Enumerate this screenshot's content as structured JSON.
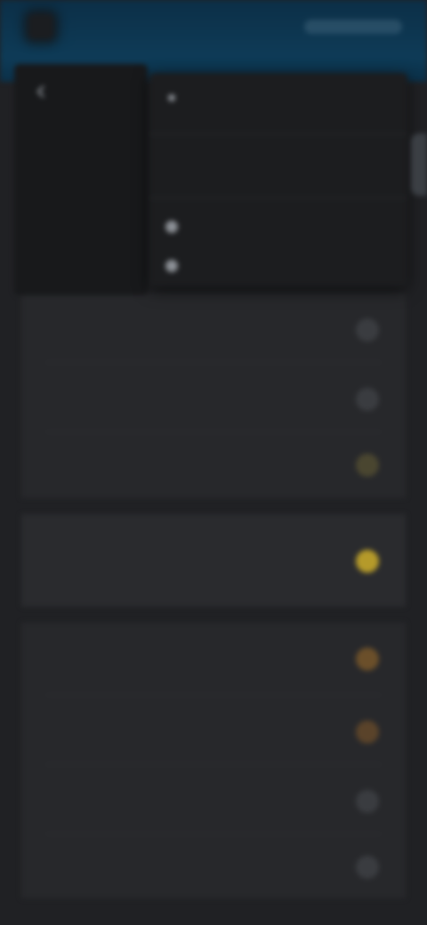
{
  "top_bar": {
    "title": "",
    "status": ""
  },
  "drawer": {
    "items": [
      {
        "sub": "",
        "main": ""
      },
      {
        "sub": "",
        "main": ""
      }
    ]
  },
  "menu": {
    "items": [
      {
        "label": "",
        "icon": "chevron-right-icon"
      },
      {
        "label": "",
        "icon": "none"
      },
      {
        "label": "",
        "icon": "circle-icon"
      },
      {
        "label": "",
        "icon": "circle-icon"
      }
    ]
  },
  "list": {
    "rows": [
      {
        "sub": "",
        "main": "",
        "badge_color": "#3a3c40"
      },
      {
        "sub": "",
        "main": "",
        "badge_color": "#3a3c40"
      },
      {
        "sub": "",
        "main": "",
        "badge_color": "#4a4630"
      },
      {
        "sub": "",
        "main": "",
        "badge_color": "#b59a2a"
      },
      {
        "sub": "",
        "main": "",
        "badge_color": "#6b4f2a"
      },
      {
        "sub": "",
        "main": "",
        "badge_color": "#5a432a"
      },
      {
        "sub": "",
        "main": "",
        "badge_color": "#3a3c40"
      },
      {
        "sub": "",
        "main": "",
        "badge_color": "#3a3c40"
      }
    ]
  },
  "colors": {
    "header_blue": "#0e3b57",
    "background": "#202124",
    "card": "#27282b",
    "accent_yellow": "#b59a2a",
    "accent_orange": "#6b4f2a"
  }
}
